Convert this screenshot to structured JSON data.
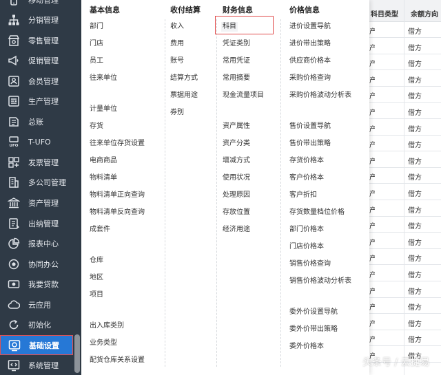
{
  "sidebar": {
    "items": [
      {
        "label": "移动管理",
        "icon": "phone-icon"
      },
      {
        "label": "分销管理",
        "icon": "org-tree-icon"
      },
      {
        "label": "零售管理",
        "icon": "shop-icon"
      },
      {
        "label": "促销管理",
        "icon": "megaphone-icon"
      },
      {
        "label": "会员管理",
        "icon": "member-card-icon"
      },
      {
        "label": "生产管理",
        "icon": "production-icon"
      },
      {
        "label": "总账",
        "icon": "ledger-icon"
      },
      {
        "label": "T-UFO",
        "icon": "ufo-icon"
      },
      {
        "label": "发票管理",
        "icon": "invoice-icon"
      },
      {
        "label": "多公司管理",
        "icon": "building-icon"
      },
      {
        "label": "资产管理",
        "icon": "bank-icon"
      },
      {
        "label": "出纳管理",
        "icon": "cashier-icon"
      },
      {
        "label": "报表中心",
        "icon": "pie-chart-icon"
      },
      {
        "label": "协同办公",
        "icon": "collaboration-icon"
      },
      {
        "label": "我要贷款",
        "icon": "loan-icon"
      },
      {
        "label": "云应用",
        "icon": "cloud-icon"
      },
      {
        "label": "初始化",
        "icon": "refresh-icon"
      },
      {
        "label": "基础设置",
        "icon": "settings-gear-icon"
      },
      {
        "label": "系统管理",
        "icon": "code-window-icon"
      }
    ],
    "active_index": 17,
    "colors": {
      "background": "#2f3a46",
      "active": "#2678d6",
      "highlight_border": "#e35151"
    }
  },
  "menu": {
    "columns": [
      {
        "title": "基本信息",
        "items": [
          {
            "label": "部门"
          },
          {
            "label": "门店"
          },
          {
            "label": "员工"
          },
          {
            "label": "往来单位"
          },
          {
            "label": "计量单位"
          },
          {
            "label": "存货"
          },
          {
            "label": "往来单位存货设置"
          },
          {
            "label": "电商商品"
          },
          {
            "label": "物料清单"
          },
          {
            "label": "物料清单正向查询"
          },
          {
            "label": "物料清单反向查询"
          },
          {
            "label": "成套件"
          },
          {
            "label": "仓库"
          },
          {
            "label": "地区"
          },
          {
            "label": "项目"
          },
          {
            "label": "出入库类别"
          },
          {
            "label": "业务类型"
          },
          {
            "label": "配货仓库关系设置"
          }
        ]
      },
      {
        "title": "收付结算",
        "items": [
          {
            "label": "收入"
          },
          {
            "label": "费用"
          },
          {
            "label": "账号"
          },
          {
            "label": "结算方式"
          },
          {
            "label": "票据用途"
          },
          {
            "label": "券别"
          }
        ]
      },
      {
        "title": "财务信息",
        "items": [
          {
            "label": "科目",
            "selected": true
          },
          {
            "label": "凭证类别"
          },
          {
            "label": "常用凭证"
          },
          {
            "label": "常用摘要"
          },
          {
            "label": "现金流量项目"
          },
          {
            "label": "资产属性"
          },
          {
            "label": "资产分类"
          },
          {
            "label": "增减方式"
          },
          {
            "label": "使用状况"
          },
          {
            "label": "处理原因"
          },
          {
            "label": "存放位置"
          },
          {
            "label": "经济用途"
          }
        ]
      },
      {
        "title": "价格信息",
        "items": [
          {
            "label": "进价设置导航"
          },
          {
            "label": "进价带出策略"
          },
          {
            "label": "供应商价格本"
          },
          {
            "label": "采购价格查询"
          },
          {
            "label": "采购价格波动分析表"
          },
          {
            "label": "售价设置导航"
          },
          {
            "label": "售价带出策略"
          },
          {
            "label": "存货价格本"
          },
          {
            "label": "客户价格本"
          },
          {
            "label": "客户折扣"
          },
          {
            "label": "存货数量档位价格"
          },
          {
            "label": "部门价格本"
          },
          {
            "label": "门店价格本"
          },
          {
            "label": "销售价格查询"
          },
          {
            "label": "销售价格波动分析表"
          },
          {
            "label": "委外价设置导航"
          },
          {
            "label": "委外价带出策略"
          },
          {
            "label": "委外价格本"
          }
        ]
      }
    ]
  },
  "background_table": {
    "headers": [
      "科目类型",
      "余额方向"
    ],
    "rows": [
      [
        "产",
        "借方"
      ],
      [
        "产",
        "借方"
      ],
      [
        "产",
        "借方"
      ],
      [
        "产",
        "借方"
      ],
      [
        "产",
        "借方"
      ],
      [
        "产",
        "借方"
      ],
      [
        "产",
        "借方"
      ],
      [
        "产",
        "借方"
      ],
      [
        "产",
        "借方"
      ],
      [
        "产",
        "借方"
      ],
      [
        "产",
        "借方"
      ],
      [
        "产",
        "借方"
      ],
      [
        "产",
        "借方"
      ],
      [
        "产",
        "借方"
      ],
      [
        "产",
        "借方"
      ],
      [
        "产",
        "借方"
      ],
      [
        "产",
        "借方"
      ],
      [
        "产",
        "借方"
      ],
      [
        "产",
        "借方"
      ],
      [
        "产",
        "借方"
      ],
      [
        "产",
        "借方"
      ]
    ]
  },
  "watermark": "头条号 / 云捷易"
}
